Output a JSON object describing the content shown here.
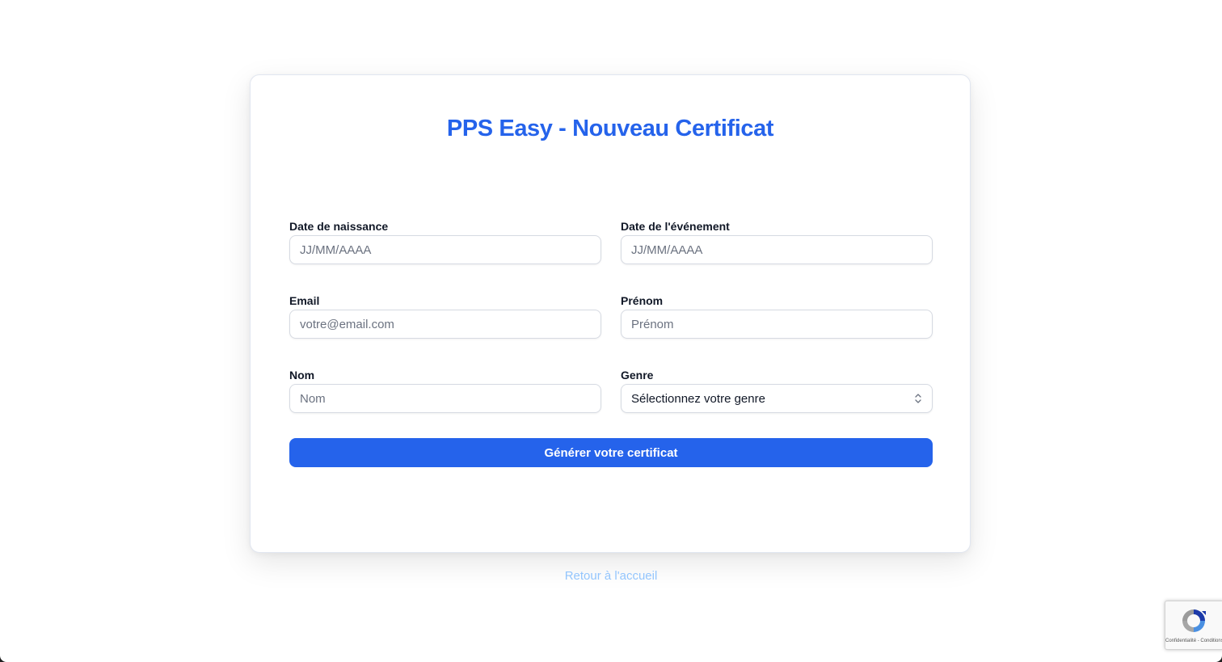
{
  "page": {
    "title": "PPS Easy - Nouveau Certificat",
    "back_link": "Retour à l'accueil"
  },
  "form": {
    "birth_date": {
      "label": "Date de naissance",
      "placeholder": "JJ/MM/AAAA",
      "value": ""
    },
    "event_date": {
      "label": "Date de l'événement",
      "placeholder": "JJ/MM/AAAA",
      "value": ""
    },
    "email": {
      "label": "Email",
      "placeholder": "votre@email.com",
      "value": ""
    },
    "first_name": {
      "label": "Prénom",
      "placeholder": "Prénom",
      "value": ""
    },
    "last_name": {
      "label": "Nom",
      "placeholder": "Nom",
      "value": ""
    },
    "gender": {
      "label": "Genre",
      "selected": "Sélectionnez votre genre"
    },
    "submit_label": "Générer votre certificat"
  },
  "recaptcha": {
    "terms": "Confidentialité - Conditions"
  },
  "colors": {
    "accent": "#2563eb",
    "link": "#93c5fd",
    "label": "#111827",
    "placeholder": "#6b7280"
  },
  "icons": {
    "select_chevron": "chevron-up-down-icon",
    "recaptcha": "recaptcha-logo-icon"
  }
}
